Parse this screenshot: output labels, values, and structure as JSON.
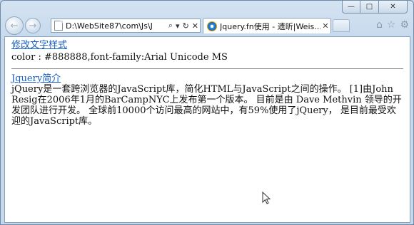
{
  "window": {
    "caption": {
      "minimize": "—",
      "maximize": "□",
      "close": "✕"
    }
  },
  "navbar": {
    "back_glyph": "←",
    "forward_glyph": "→",
    "address": {
      "url": "D:\\WebSite87\\com\\Js\\J",
      "search_glyph": "⌕",
      "dropdown_glyph": "▾",
      "refresh_glyph": "↻",
      "stop_glyph": "✕"
    },
    "tab": {
      "title": "Jquery.fn使用 - 遗昕|Weis...",
      "close_glyph": "✕"
    },
    "icons": {
      "home": "⌂",
      "favorites": "☆",
      "tools": "⚙"
    }
  },
  "content": {
    "link_style": "修改文字样式",
    "color_info": "color : #888888,font-family:Arial Unicode MS",
    "link_intro": "Jquery简介",
    "intro_text": "jQuery是一套跨浏览器的JavaScript库，简化HTML与JavaScript之间的操作。 [1]由John Resig在2006年1月的BarCampNYC上发布第一个版本。 目前是由 Dave Methvin 领导的开发团队进行开发。 全球前10000个访问最高的网站中，有59%使用了jQuery， 是目前最受欢迎的JavaScript库。"
  },
  "colors": {
    "link": "#1a5fc4",
    "frame": "#c5d8ec"
  }
}
